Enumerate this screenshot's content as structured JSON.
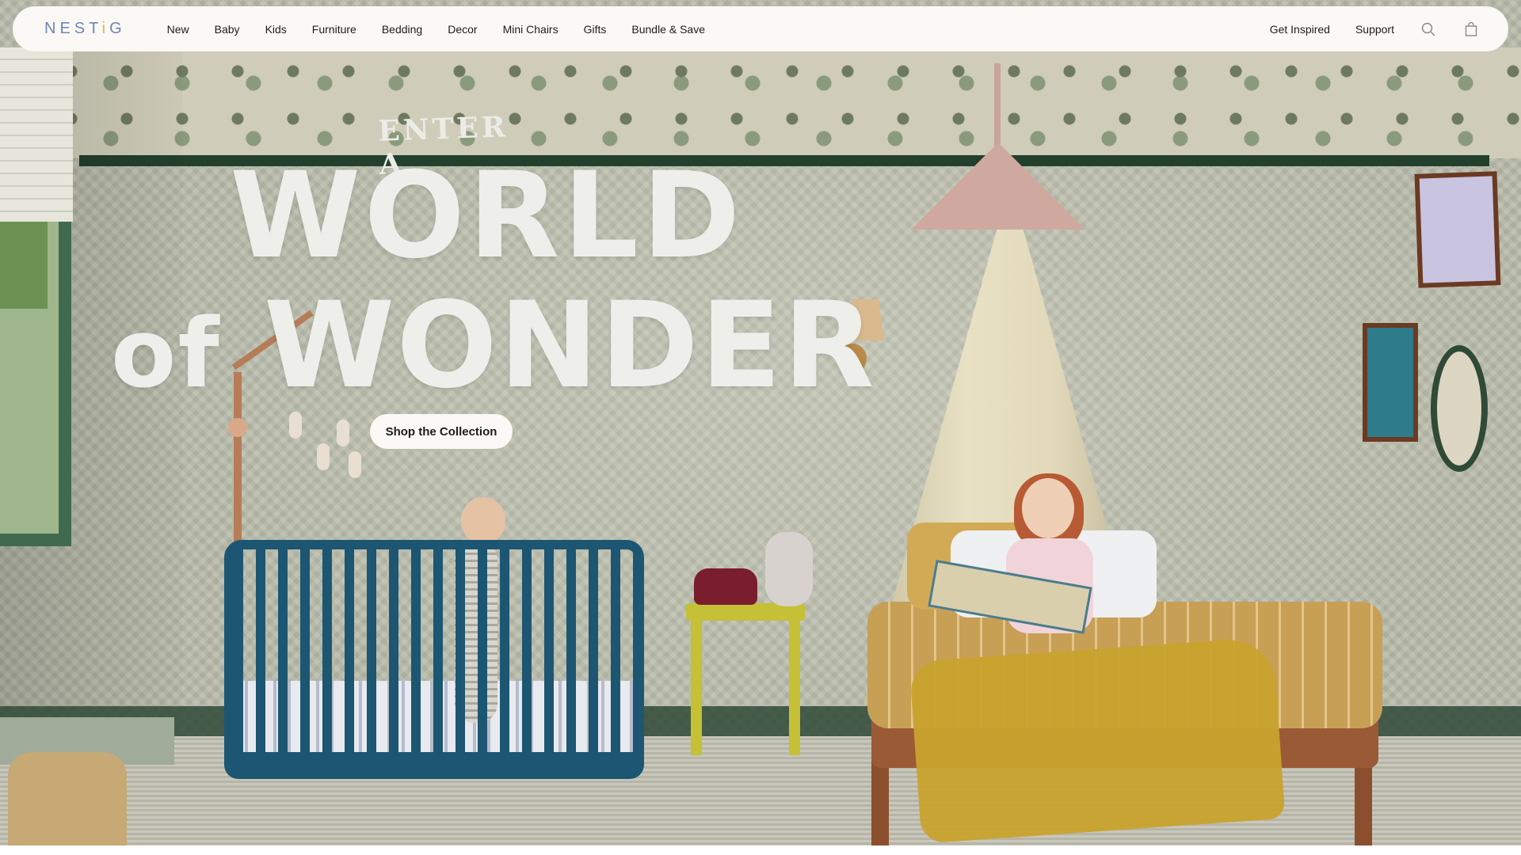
{
  "brand": {
    "logo_pre": "NEST",
    "logo_i": "i",
    "logo_post": "G",
    "logo_color": "#6d85b8",
    "logo_accent": "#e9b54a"
  },
  "nav": {
    "items": [
      {
        "label": "New"
      },
      {
        "label": "Baby"
      },
      {
        "label": "Kids"
      },
      {
        "label": "Furniture"
      },
      {
        "label": "Bedding"
      },
      {
        "label": "Decor"
      },
      {
        "label": "Mini Chairs"
      },
      {
        "label": "Gifts"
      },
      {
        "label": "Bundle & Save"
      }
    ],
    "right": [
      {
        "label": "Get Inspired"
      },
      {
        "label": "Support"
      }
    ],
    "icons": [
      "search-icon",
      "cart-icon"
    ]
  },
  "hero": {
    "eyebrow": "ENTER A",
    "headline_line1": "WORLD",
    "headline_of": "of",
    "headline_line2": "WONDER",
    "cta_label": "Shop the Collection",
    "text_color": "#eeeeea",
    "scene": "nursery"
  }
}
